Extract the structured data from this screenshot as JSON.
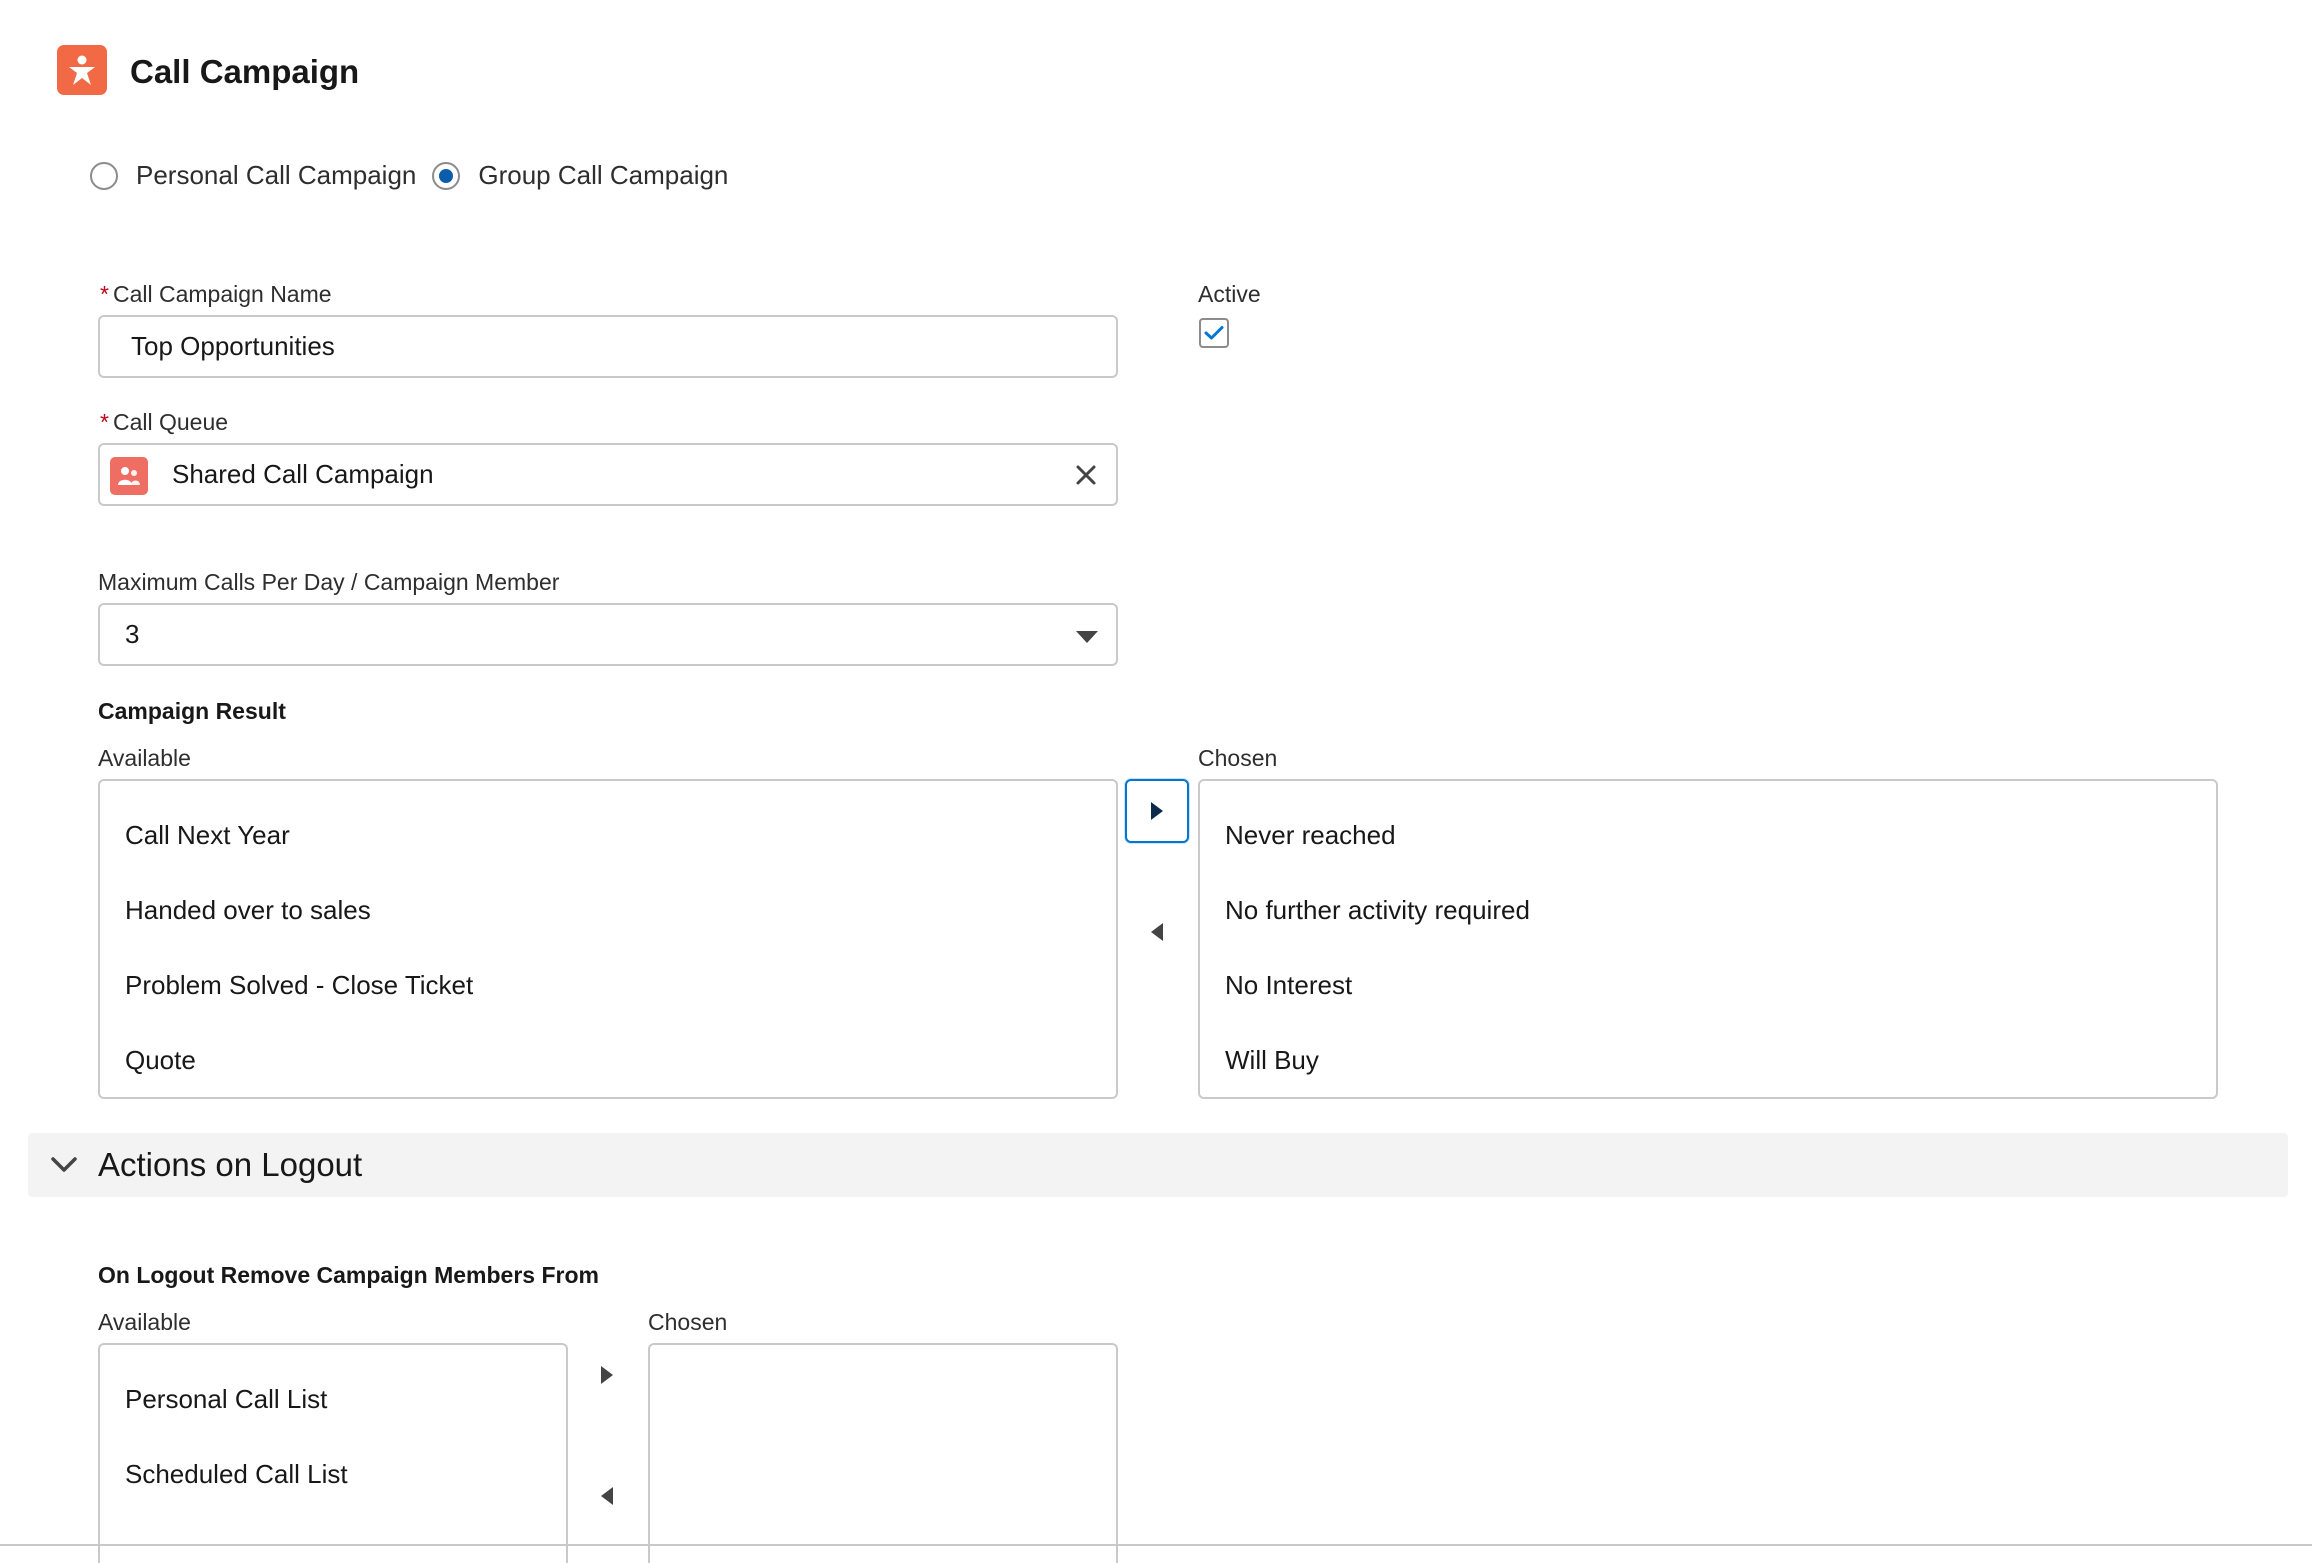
{
  "header": {
    "title": "Call Campaign",
    "icon": "call-campaign-icon"
  },
  "campaign_type": {
    "options": [
      {
        "label": "Personal Call Campaign",
        "selected": false
      },
      {
        "label": "Group Call Campaign",
        "selected": true
      }
    ]
  },
  "form": {
    "name_label": "Call Campaign Name",
    "name_value": "Top Opportunities",
    "active_label": "Active",
    "active_checked": true,
    "queue_label": "Call Queue",
    "queue_value": "Shared Call Campaign",
    "max_calls_label": "Maximum Calls Per Day / Campaign Member",
    "max_calls_value": "3"
  },
  "campaign_result": {
    "title": "Campaign Result",
    "available_label": "Available",
    "chosen_label": "Chosen",
    "available": [
      "Call Next Year",
      "Handed over to sales",
      "Problem Solved - Close Ticket",
      "Quote"
    ],
    "chosen": [
      "Never reached",
      "No further activity required",
      "No Interest",
      "Will Buy"
    ]
  },
  "actions_on_logout": {
    "title": "Actions on Logout",
    "expanded": true,
    "remove_title": "On Logout Remove Campaign Members From",
    "available_label": "Available",
    "chosen_label": "Chosen",
    "available": [
      "Personal Call List",
      "Scheduled Call List"
    ],
    "chosen": []
  },
  "colors": {
    "brand_icon": "#f26a45",
    "queue_icon": "#ef6e64",
    "accent_blue": "#0176d3",
    "required": "#ba0517"
  }
}
